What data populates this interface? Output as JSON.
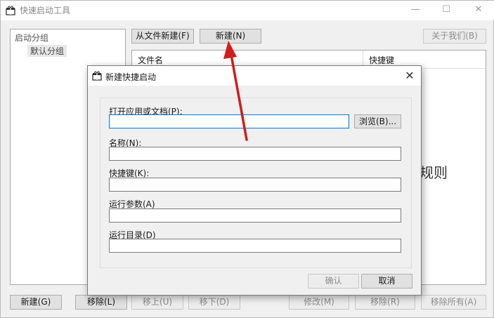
{
  "window": {
    "title": "快速启动工具",
    "icon": "gift-box-icon",
    "minimize": "—",
    "maximize": "☐",
    "close": "✕"
  },
  "toolbar": {
    "from_file_new": "从文件新建(F)",
    "new": "新建(N)",
    "about": "关于我们(B)"
  },
  "tree": {
    "root": "启动分组",
    "child": "默认分组"
  },
  "list": {
    "col_name": "文件名",
    "col_shortcut": "快捷键",
    "empty_hint": "规则"
  },
  "bottom": {
    "new_group": "新建(G)",
    "remove": "移除(L)",
    "move_up": "移上(U)",
    "move_down": "移下(D)",
    "edit": "修改(M)",
    "remove_r": "移除(R)",
    "remove_all": "移除所有(A)"
  },
  "dialog": {
    "title": "新建快捷启动",
    "close": "✕",
    "open_label": "打开应用或文档(P):",
    "open_value": "",
    "browse": "浏览(B)...",
    "name_label": "名称(N):",
    "name_value": "",
    "hotkey_label": "快捷键(K):",
    "hotkey_value": "",
    "args_label": "运行参数(A)",
    "args_value": "",
    "dir_label": "运行目录(D)",
    "dir_value": "",
    "ok": "确认",
    "cancel": "取消"
  },
  "colors": {
    "annotation_arrow": "#d21c1c",
    "focus_border": "#0078d7",
    "window_bg": "#f0f0f0"
  }
}
